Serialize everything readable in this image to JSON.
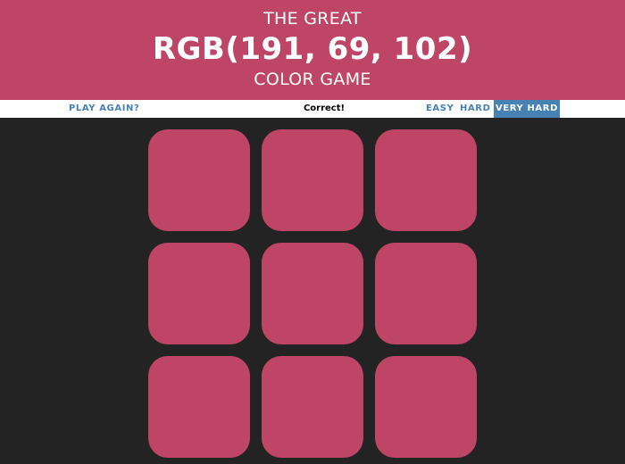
{
  "header": {
    "line_top": "THE GREAT",
    "rgb_display": "RGB(191, 69, 102)",
    "line_bottom": "COLOR GAME",
    "background_color": "#bf4566"
  },
  "stripe": {
    "reset_label": "PLAY AGAIN?",
    "message": "Correct!",
    "modes": [
      "EASY",
      "HARD",
      "VERY HARD"
    ],
    "selected_mode": "VERY HARD",
    "accent_color": "#4682b4"
  },
  "board": {
    "background_color": "#232323",
    "squares": [
      {
        "color": "#bf4566"
      },
      {
        "color": "#bf4566"
      },
      {
        "color": "#bf4566"
      },
      {
        "color": "#bf4566"
      },
      {
        "color": "#bf4566"
      },
      {
        "color": "#bf4566"
      },
      {
        "color": "#bf4566"
      },
      {
        "color": "#bf4566"
      },
      {
        "color": "#bf4566"
      }
    ]
  }
}
